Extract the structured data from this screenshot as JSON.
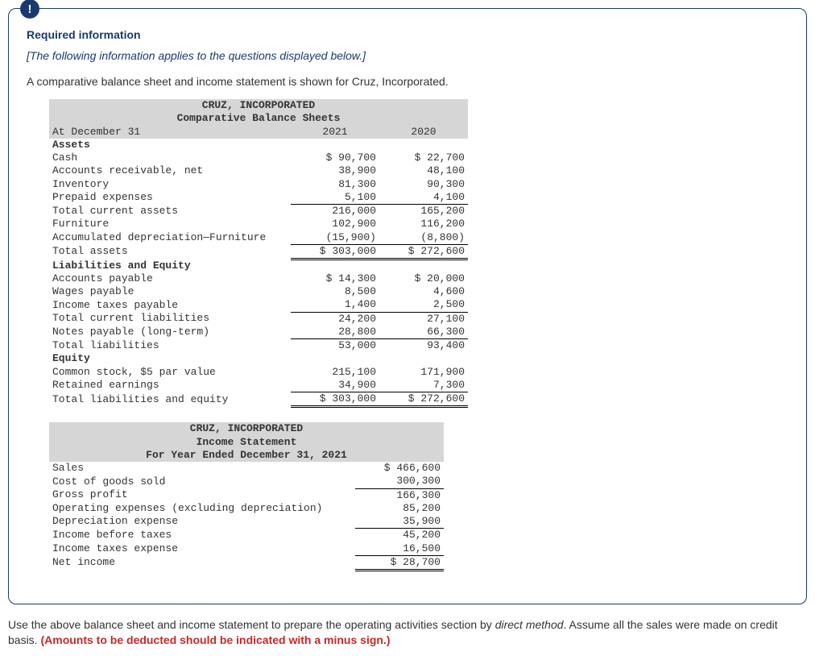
{
  "badge_glyph": "!",
  "heading": "Required information",
  "applies_note": "[The following information applies to the questions displayed below.]",
  "intro": "A comparative balance sheet and income statement is shown for Cruz, Incorporated.",
  "bs": {
    "company": "CRUZ, INCORPORATED",
    "title": "Comparative Balance Sheets",
    "date_label": "At December 31",
    "col1": "2021",
    "col2": "2020",
    "assets_hdr": "Assets",
    "rows": [
      {
        "label": "Cash",
        "a": "$ 90,700",
        "b": "$ 22,700"
      },
      {
        "label": "Accounts receivable, net",
        "a": "38,900",
        "b": "48,100"
      },
      {
        "label": "Inventory",
        "a": "81,300",
        "b": "90,300"
      },
      {
        "label": "Prepaid expenses",
        "a": "5,100",
        "b": "4,100"
      },
      {
        "label": "Total current assets",
        "a": "216,000",
        "b": "165,200"
      },
      {
        "label": "Furniture",
        "a": "102,900",
        "b": "116,200"
      },
      {
        "label": "Accumulated depreciation—Furniture",
        "a": "(15,900)",
        "b": "(8,800)"
      },
      {
        "label": "Total assets",
        "a": "$ 303,000",
        "b": "$ 272,600"
      }
    ],
    "liab_hdr": "Liabilities and Equity",
    "lrows": [
      {
        "label": "Accounts payable",
        "a": "$ 14,300",
        "b": "$ 20,000"
      },
      {
        "label": "Wages payable",
        "a": "8,500",
        "b": "4,600"
      },
      {
        "label": "Income taxes payable",
        "a": "1,400",
        "b": "2,500"
      },
      {
        "label": "Total current liabilities",
        "a": "24,200",
        "b": "27,100"
      },
      {
        "label": "Notes payable (long-term)",
        "a": "28,800",
        "b": "66,300"
      },
      {
        "label": "Total liabilities",
        "a": "53,000",
        "b": "93,400"
      }
    ],
    "eq_hdr": "Equity",
    "erows": [
      {
        "label": "Common stock, $5 par value",
        "a": "215,100",
        "b": "171,900"
      },
      {
        "label": "Retained earnings",
        "a": "34,900",
        "b": "7,300"
      },
      {
        "label": "Total liabilities and equity",
        "a": "$ 303,000",
        "b": "$ 272,600"
      }
    ]
  },
  "is": {
    "company": "CRUZ, INCORPORATED",
    "title": "Income Statement",
    "period": "For Year Ended December 31, 2021",
    "rows": [
      {
        "label": "Sales",
        "a": "$ 466,600"
      },
      {
        "label": "Cost of goods sold",
        "a": "300,300"
      },
      {
        "label": "Gross profit",
        "a": "166,300"
      },
      {
        "label": "Operating expenses (excluding depreciation)",
        "a": "85,200"
      },
      {
        "label": "Depreciation expense",
        "a": "35,900"
      },
      {
        "label": "Income before taxes",
        "a": "45,200"
      },
      {
        "label": "Income taxes expense",
        "a": "16,500"
      },
      {
        "label": "Net income",
        "a": "$ 28,700"
      }
    ]
  },
  "instructions": {
    "pre": "Use the above balance sheet and income statement to prepare the operating activities section by ",
    "ital": "direct method",
    "post": ". Assume all the sales were made on credit basis. ",
    "warn": "(Amounts to be deducted should be indicated with a minus sign.)"
  }
}
